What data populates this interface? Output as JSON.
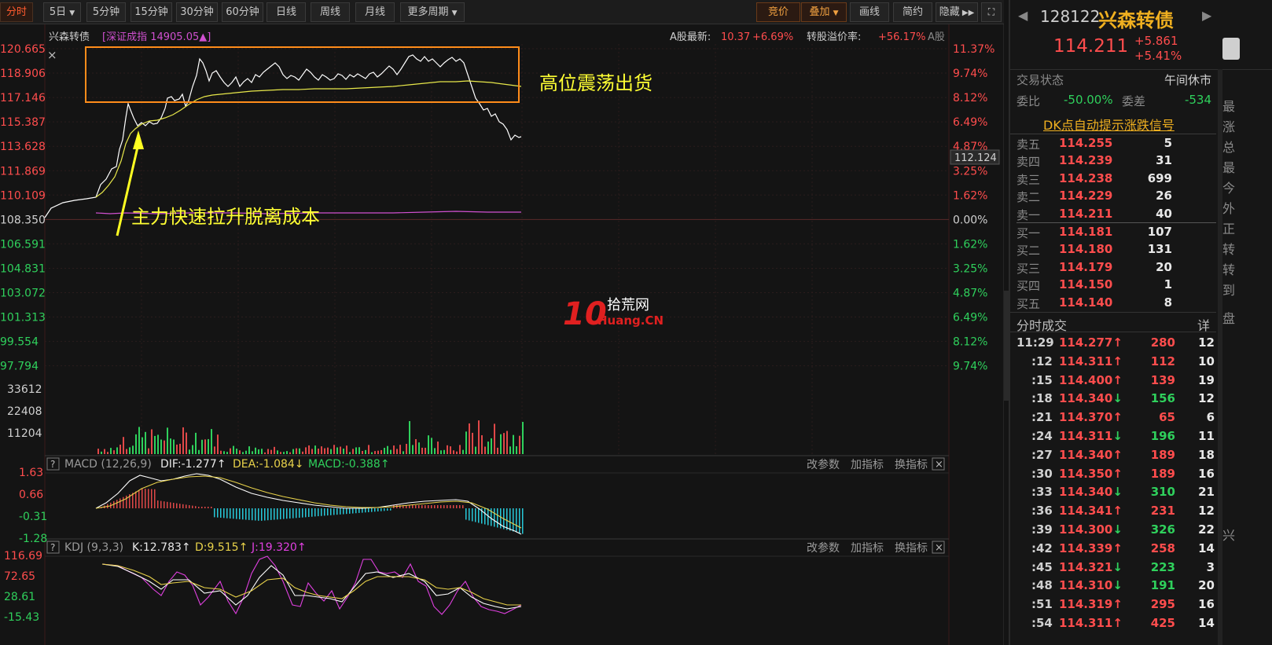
{
  "toolbar": {
    "left_tabs": [
      "分时",
      "5日",
      "5分钟",
      "15分钟",
      "30分钟",
      "60分钟",
      "日线",
      "周线",
      "月线",
      "更多周期"
    ],
    "right_buttons": [
      "竞价",
      "叠加",
      "画线",
      "简约",
      "隐藏"
    ]
  },
  "info_bar": {
    "name": "兴森转债",
    "index": "[深证成指 14905.05▲]",
    "a_latest_label": "A股最新:",
    "a_latest_price": "10.37",
    "a_latest_pct": "+6.69%",
    "premium_label": "转股溢价率:",
    "premium_value": "+56.17%",
    "a_tab": "A股"
  },
  "price_axis": {
    "left": [
      "120.665",
      "118.906",
      "117.146",
      "115.387",
      "113.628",
      "111.869",
      "110.109",
      "108.350",
      "106.591",
      "104.831",
      "103.072",
      "101.313",
      "99.554",
      "97.794"
    ],
    "right": [
      "11.37%",
      "9.74%",
      "8.12%",
      "6.49%",
      "4.87%",
      "3.25%",
      "1.62%",
      "0.00%",
      "1.62%",
      "3.25%",
      "4.87%",
      "6.49%",
      "8.12%",
      "9.74%"
    ],
    "crosshair_value": "112.124"
  },
  "volume_axis": [
    "33612",
    "22408",
    "11204"
  ],
  "annotations": {
    "box_text": "高位震荡出货",
    "arrow_text": "主力快速拉升脱离成本"
  },
  "watermark": {
    "big": "10",
    "cn": "拾荒网",
    "en": "Huang.CN"
  },
  "macd": {
    "title": "MACD (12,26,9)",
    "dif": "DIF:-1.277↑",
    "dea": "DEA:-1.084↓",
    "macd": "MACD:-0.388↑",
    "axis": [
      "1.63",
      "0.66",
      "-0.31",
      "-1.28"
    ]
  },
  "kdj": {
    "title": "KDJ (9,3,3)",
    "k": "K:12.783↑",
    "d": "D:9.515↑",
    "j": "J:19.320↑",
    "axis": [
      "116.69",
      "72.65",
      "28.61",
      "-15.43"
    ]
  },
  "panel_buttons": [
    "改参数",
    "加指标",
    "换指标"
  ],
  "colors": {
    "up": "#ff4d4d",
    "down": "#2fd05c",
    "price_line": "#ffffff",
    "avg_line": "#e8e84a",
    "accent": "#ff8c1a"
  },
  "quote": {
    "code": "128122",
    "name": "兴森转债",
    "price": "114.211",
    "change": "+5.861",
    "change_pct": "+5.41%",
    "status_label": "交易状态",
    "status_value": "午间休市",
    "weibi_label": "委比",
    "weibi_value": "-50.00%",
    "weicha_label": "委差",
    "weicha_value": "-534",
    "dk_link": "DK点自动提示涨跌信号",
    "right_edge_chars": [
      "最",
      "涨",
      "总",
      "最",
      "今",
      "外",
      "正",
      "转",
      "转",
      "到",
      "盘",
      "兴"
    ]
  },
  "order_book": {
    "asks": [
      {
        "label": "卖五",
        "price": "114.255",
        "vol": "5"
      },
      {
        "label": "卖四",
        "price": "114.239",
        "vol": "31"
      },
      {
        "label": "卖三",
        "price": "114.238",
        "vol": "699"
      },
      {
        "label": "卖二",
        "price": "114.229",
        "vol": "26"
      },
      {
        "label": "卖一",
        "price": "114.211",
        "vol": "40"
      }
    ],
    "bids": [
      {
        "label": "买一",
        "price": "114.181",
        "vol": "107"
      },
      {
        "label": "买二",
        "price": "114.180",
        "vol": "131"
      },
      {
        "label": "买三",
        "price": "114.179",
        "vol": "20"
      },
      {
        "label": "买四",
        "price": "114.150",
        "vol": "1"
      },
      {
        "label": "买五",
        "price": "114.140",
        "vol": "8"
      }
    ]
  },
  "ticks": {
    "title": "分时成交",
    "detail": "详",
    "rows": [
      {
        "time": "11:29",
        "price": "114.277",
        "dir": "up",
        "vol": "280",
        "n": "12"
      },
      {
        "time": ":12",
        "price": "114.311",
        "dir": "up",
        "vol": "112",
        "n": "10"
      },
      {
        "time": ":15",
        "price": "114.400",
        "dir": "up",
        "vol": "139",
        "n": "19"
      },
      {
        "time": ":18",
        "price": "114.340",
        "dir": "down",
        "vol": "156",
        "n": "12"
      },
      {
        "time": ":21",
        "price": "114.370",
        "dir": "up",
        "vol": "65",
        "n": "6"
      },
      {
        "time": ":24",
        "price": "114.311",
        "dir": "down",
        "vol": "196",
        "n": "11"
      },
      {
        "time": ":27",
        "price": "114.340",
        "dir": "up",
        "vol": "189",
        "n": "18"
      },
      {
        "time": ":30",
        "price": "114.350",
        "dir": "up",
        "vol": "189",
        "n": "16"
      },
      {
        "time": ":33",
        "price": "114.340",
        "dir": "down",
        "vol": "310",
        "n": "21"
      },
      {
        "time": ":36",
        "price": "114.341",
        "dir": "up",
        "vol": "231",
        "n": "12"
      },
      {
        "time": ":39",
        "price": "114.300",
        "dir": "down",
        "vol": "326",
        "n": "22"
      },
      {
        "time": ":42",
        "price": "114.339",
        "dir": "up",
        "vol": "258",
        "n": "14"
      },
      {
        "time": ":45",
        "price": "114.321",
        "dir": "down",
        "vol": "223",
        "n": "3"
      },
      {
        "time": ":48",
        "price": "114.310",
        "dir": "down",
        "vol": "191",
        "n": "20"
      },
      {
        "time": ":51",
        "price": "114.319",
        "dir": "up",
        "vol": "295",
        "n": "16"
      },
      {
        "time": ":54",
        "price": "114.311",
        "dir": "up",
        "vol": "425",
        "n": "14"
      }
    ]
  }
}
